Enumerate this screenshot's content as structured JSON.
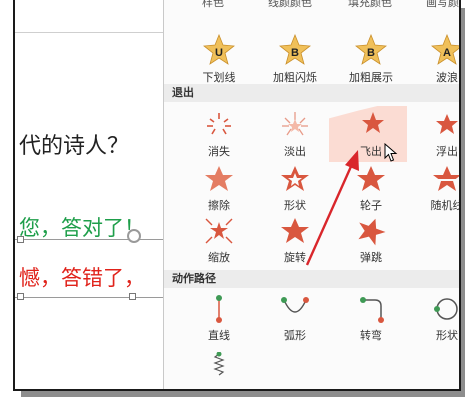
{
  "slide": {
    "question": "代的诗人？",
    "correct": "您，答对了！",
    "wrong": "憾，答错了，"
  },
  "gallery": {
    "top_cutoff": [
      "样色",
      "线颜颜色",
      "填充颜色",
      "画写颜"
    ],
    "emphasis_row": [
      {
        "label": "下划线",
        "icon": "underline-star-icon"
      },
      {
        "label": "加粗闪烁",
        "icon": "bold-flash-star-icon"
      },
      {
        "label": "加粗展示",
        "icon": "bold-reveal-star-icon"
      },
      {
        "label": "波浪",
        "icon": "wave-star-icon"
      }
    ],
    "exit_section": "退出",
    "exit_items": [
      {
        "label": "消失",
        "icon": "disappear-icon"
      },
      {
        "label": "淡出",
        "icon": "fade-icon"
      },
      {
        "label": "飞出",
        "icon": "fly-out-icon"
      },
      {
        "label": "浮出",
        "icon": "float-out-icon"
      },
      {
        "label": "擦除",
        "icon": "wipe-icon"
      },
      {
        "label": "形状",
        "icon": "shape-icon"
      },
      {
        "label": "轮子",
        "icon": "wheel-icon"
      },
      {
        "label": "随机线",
        "icon": "random-bars-icon"
      },
      {
        "label": "缩放",
        "icon": "zoom-icon"
      },
      {
        "label": "旋转",
        "icon": "swivel-icon"
      },
      {
        "label": "弹跳",
        "icon": "bounce-icon"
      }
    ],
    "path_section": "动作路径",
    "path_items": [
      {
        "label": "直线",
        "icon": "line-path-icon"
      },
      {
        "label": "弧形",
        "icon": "arc-path-icon"
      },
      {
        "label": "转弯",
        "icon": "turn-path-icon"
      },
      {
        "label": "形状",
        "icon": "shape-path-icon"
      }
    ],
    "colors": {
      "accent": "#d9573f",
      "gold": "#f0c05a",
      "highlight": "#fbdcd3",
      "arrow": "#d9262b"
    }
  }
}
